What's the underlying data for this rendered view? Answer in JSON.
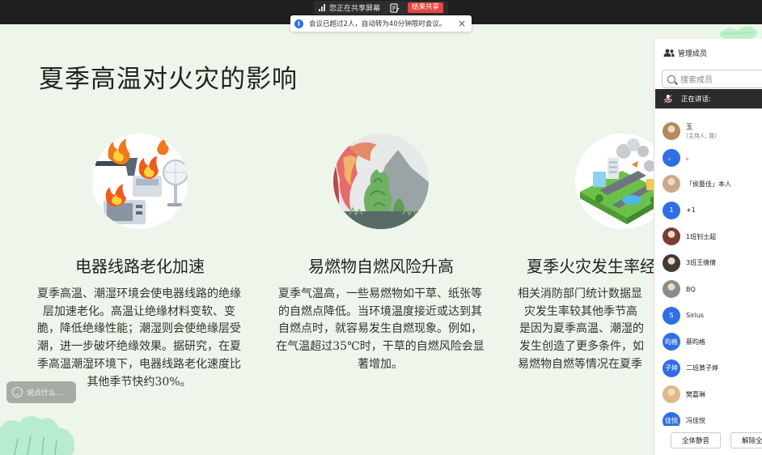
{
  "share_bar": {
    "status": "您正在共享屏幕",
    "end_label": "结束共享"
  },
  "notice": {
    "message": "会议已超过2人，自动转为40分钟限时会议。",
    "close_symbol": "×"
  },
  "slide": {
    "title": "夏季高温对火灾的影响",
    "sections": [
      {
        "heading": "电器线路老化加速",
        "body": "夏季高温、潮湿环境会使电器线路的绝缘层加速老化。高温让绝缘材料变软、变脆，降低绝缘性能；潮湿则会使绝缘层受潮，进一步破坏绝缘效果。据研究，在夏季高温潮湿环境下，电器线路老化速度比其他季节快约30%。",
        "icon": "electrical-fire-icon"
      },
      {
        "heading": "易燃物自燃风险升高",
        "body": "夏季气温高，一些易燃物如干草、纸张等的自燃点降低。当环境温度接近或达到其自燃点时，就容易发生自燃现象。例如，在气温超过35℃时，干草的自燃风险会显著增加。",
        "icon": "plant-fire-icon"
      },
      {
        "heading": "夏季火灾发生率经",
        "body_lines": [
          "相关消防部门统计数据显",
          "灾发生率较其他季节高",
          "是因为夏季高温、潮湿的",
          "发生创造了更多条件，如",
          "易燃物自燃等情况在夏季"
        ],
        "icon": "city-isometric-icon"
      }
    ],
    "chat_placeholder": "说点什么..."
  },
  "members_panel": {
    "title": "管理成员",
    "search_placeholder": "搜索成员",
    "speaking_label": "正在讲话:",
    "members": [
      {
        "name": "玉",
        "sub": "(主持人, 我)",
        "avatar_type": "photo",
        "avatar_color": "#b58a5a"
      },
      {
        "name": "。",
        "sub": "",
        "avatar_type": "text",
        "avatar_text": "。",
        "avatar_color": "#2f6fe4"
      },
      {
        "name": "「侯藝佳」本人",
        "sub": "",
        "avatar_type": "photo",
        "avatar_color": "#c9a98c"
      },
      {
        "name": "+1",
        "sub": "",
        "avatar_type": "text",
        "avatar_text": "1",
        "avatar_color": "#2f6fe4"
      },
      {
        "name": "1班钊士超",
        "sub": "",
        "avatar_type": "photo",
        "avatar_color": "#7a3b3b"
      },
      {
        "name": "3班王倩倩",
        "sub": "",
        "avatar_type": "photo",
        "avatar_color": "#3c3c3c"
      },
      {
        "name": "BQ",
        "sub": "",
        "avatar_type": "photo",
        "avatar_color": "#8c8c8c"
      },
      {
        "name": "Sirius",
        "sub": "",
        "avatar_type": "text",
        "avatar_text": "S",
        "avatar_color": "#2f6fe4"
      },
      {
        "name": "蔡昀格",
        "sub": "",
        "avatar_type": "text",
        "avatar_text": "昀格",
        "avatar_color": "#2f6fe4"
      },
      {
        "name": "二班黄子婷",
        "sub": "",
        "avatar_type": "text",
        "avatar_text": "子婷",
        "avatar_color": "#2f6fe4"
      },
      {
        "name": "樊嘉琳",
        "sub": "",
        "avatar_type": "photo",
        "avatar_color": "#e0b88a"
      },
      {
        "name": "冯佳悦",
        "sub": "",
        "avatar_type": "text",
        "avatar_text": "佳悦",
        "avatar_color": "#2f6fe4"
      }
    ],
    "mute_all_label": "全体静音",
    "unmute_all_label": "解除全体静音"
  }
}
